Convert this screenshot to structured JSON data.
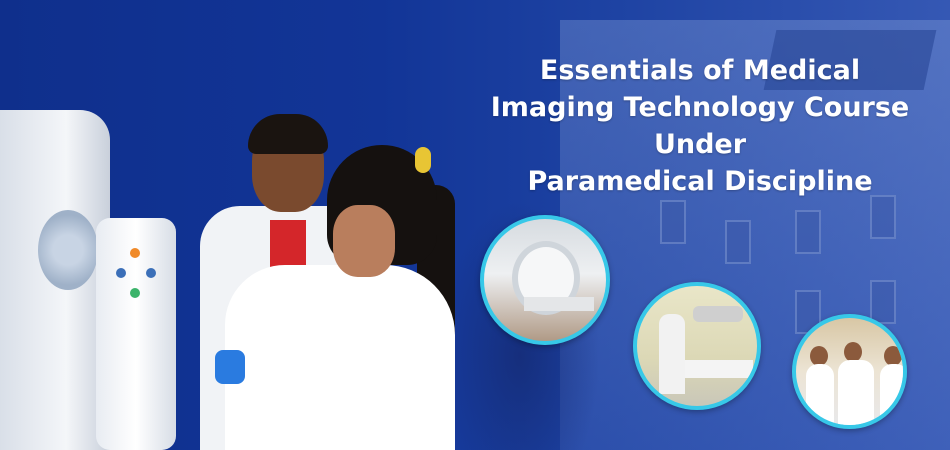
{
  "banner": {
    "title_lines": [
      "Essentials of Medical",
      "Imaging Technology Course Under",
      "Paramedical Discipline"
    ]
  },
  "colors": {
    "background": "#123597",
    "accent_ring": "#37c8e8",
    "title_text": "#ffffff"
  },
  "images": {
    "main_photo": "students-operating-imaging-machine",
    "circle_photos": [
      "ct-scanner-room",
      "x-ray-room-student",
      "students-reading-file"
    ]
  }
}
